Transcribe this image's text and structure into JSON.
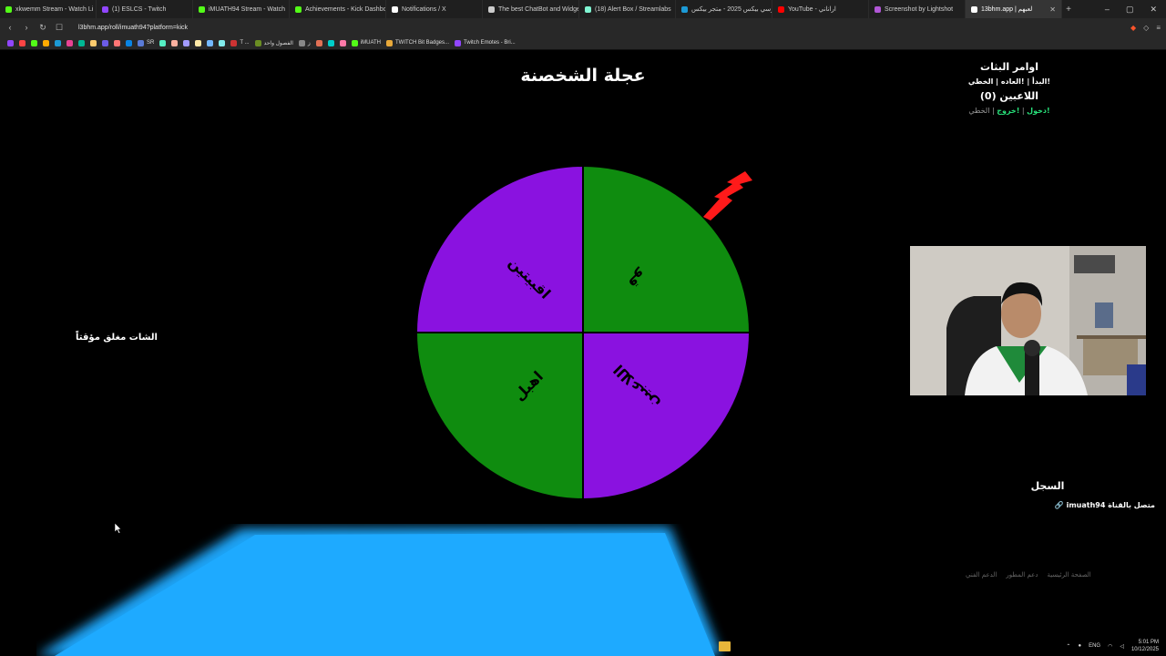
{
  "browser": {
    "tabs": [
      {
        "label": "xkwemm Stream - Watch Li",
        "color": "#53fc18"
      },
      {
        "label": "(1) ESLCS - Twitch",
        "color": "#9146ff"
      },
      {
        "label": "iMUATH94 Stream - Watch",
        "color": "#53fc18"
      },
      {
        "label": "Achievements - Kick Dashboar",
        "color": "#53fc18"
      },
      {
        "label": "Notifications / X",
        "color": "#ffffff"
      },
      {
        "label": "The best ChatBot and Widget",
        "color": "#cccccc"
      },
      {
        "label": "(18) Alert Box / Streamlabs",
        "color": "#80f5d2"
      },
      {
        "label": "جيرسي بيكس 2025 - متجر بيكس",
        "color": "#1c9ad6"
      },
      {
        "label": "YouTube - اراناني",
        "color": "#ff0000"
      },
      {
        "label": "Screenshot by Lightshot",
        "color": "#b157d6"
      },
      {
        "label": "13bhm.app | لعبهم",
        "color": "#ffffff"
      }
    ],
    "url": "l3bhm.app/roll/imuath94?platform=kick",
    "bookmarks": [
      {
        "label": "SR",
        "color": "#5a7bd6"
      },
      {
        "label": "T ...",
        "color": "#cc3333"
      },
      {
        "label": "الفصول واحد",
        "color": "#6b8e23"
      },
      {
        "label": "ز",
        "color": "#888888"
      },
      {
        "label": "iMUATH",
        "color": "#53fc18"
      },
      {
        "label": "TWITCH Bit Badges...",
        "color": "#e8a93a"
      },
      {
        "label": "Twitch Emotes - Bri...",
        "color": "#9146ff"
      }
    ]
  },
  "page": {
    "title": "عجلة الشخصنة",
    "commands_heading": "اوامر البثات",
    "commands": "!البدأ | !العاده | الخطي",
    "players_heading": "اللاعبين (0)",
    "player_cmd_join": "!دخول",
    "player_cmd_exit": "!خروج",
    "player_cmd_sep": " | ",
    "player_cmd_misc": "الخطي",
    "chat_closed": "الشات مغلق مؤقتاً",
    "log_heading": "السجل",
    "log_entry": "متصل بالقناة imuath94",
    "footer_links": [
      "الصفحة الرئيسية",
      "دعم المطور",
      "الدعم الفني"
    ]
  },
  "wheel": {
    "segments": [
      {
        "label": "قو",
        "color": "#0f8c0f"
      },
      {
        "label": "اللاعبين",
        "color": "#8a12e0"
      },
      {
        "label": "اهبل",
        "color": "#0f8c0f"
      },
      {
        "label": "اقبيتين",
        "color": "#8a12e0"
      }
    ],
    "pointer_color": "#ff1a1a"
  },
  "taskbar": {
    "lang": "ENG",
    "time": "5:01 PM",
    "date": "10/12/2025"
  },
  "icons": [
    "folder-icon",
    "wifi-icon",
    "volume-icon",
    "mic-icon",
    "cursor-icon",
    "link-icon"
  ]
}
